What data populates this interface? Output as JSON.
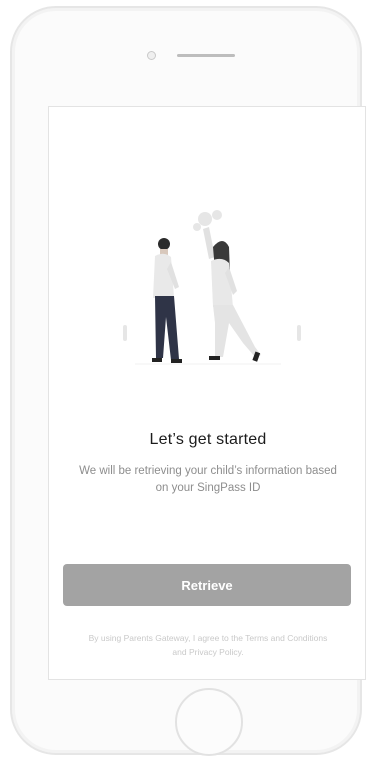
{
  "screen": {
    "title": "Let’s get started",
    "subtitle": "We will be retrieving your child’s information based on your SingPass ID",
    "retrieve_label": "Retrieve",
    "terms": "By using Parents Gateway, I agree to the Terms and Conditions and Privacy Policy."
  },
  "illustration": {
    "name": "two-people-high-five-illustration"
  },
  "colors": {
    "button": "#a3a3a3",
    "title": "#1c1c1c",
    "subtitle": "#8d8d8d"
  }
}
